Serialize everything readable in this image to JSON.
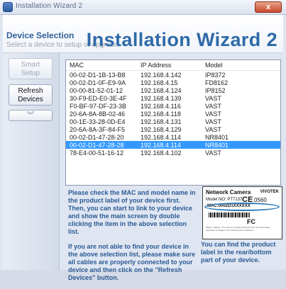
{
  "window": {
    "title": "Installation Wizard 2",
    "close_label": "x"
  },
  "header": {
    "title": "Device Selection",
    "subtitle": "Select a device to setup or upgrade",
    "brand": "Installation Wizard 2"
  },
  "sidebar": {
    "smart_setup": "Smart Setup",
    "refresh_devices": "Refresh Devices",
    "more_icon": "double-chevron-down-icon",
    "more_glyph": "︾"
  },
  "device_list": {
    "columns": [
      "MAC",
      "IP Address",
      "Model"
    ],
    "selected_index": 9,
    "rows": [
      [
        "00-02-D1-1B-13-B8",
        "192.168.4.142",
        "IP8372"
      ],
      [
        "00-02-D1-0F-E9-9A",
        "192.168.4.15",
        "FD8162"
      ],
      [
        "00-00-81-52-01-12",
        "192.168.4.124",
        "IP8152"
      ],
      [
        "30-F9-ED-E0-3E-4F",
        "192.168.4.139",
        "VAST"
      ],
      [
        "F0-BF-97-DF-23-3B",
        "192.168.4.116",
        "VAST"
      ],
      [
        "20-6A-8A-8B-02-46",
        "192.168.4.118",
        "VAST"
      ],
      [
        "00-1E-33-28-0D-E4",
        "192.168.4.131",
        "VAST"
      ],
      [
        "20-6A-8A-3F-84-F5",
        "192.168.4.129",
        "VAST"
      ],
      [
        "00-02-D1-47-28-20",
        "192.168.4.114",
        "NR8401"
      ],
      [
        "00-02-D1-47-28-28",
        "192.168.4.114",
        "NR8401"
      ],
      [
        "78-E4-00-51-16-12",
        "192.168.4.102",
        "VAST"
      ]
    ]
  },
  "info": {
    "paragraph1": "Please check the MAC and model name in the product label of your device first. Then, you can start to link to your device and show the main screen by double clicking the item in the above selection list.",
    "paragraph2": "If you are not able to find your device in the above selection list, please make sure all cables are properly connected to your device and then click on the \"Refresh Devices\" button."
  },
  "product_label": {
    "title": "Network Camera",
    "brand": "VIVOTEK",
    "model_text": "Model NO: PT7137",
    "ce_mark": "CE",
    "cert_number": "0560",
    "mac_text": "MAC:0002D1XXXXXX",
    "fc_mark": "FC",
    "fine_print": "Made in Taiwan. This device complies with part 15 of the FCC Rules. Operation is subject to the following two conditions.",
    "caption": "You can find the product label in the rear/bottom part of your device."
  },
  "colors": {
    "accent": "#2f6aa8",
    "selection": "#3399ff",
    "info_text": "#2b5a94"
  }
}
